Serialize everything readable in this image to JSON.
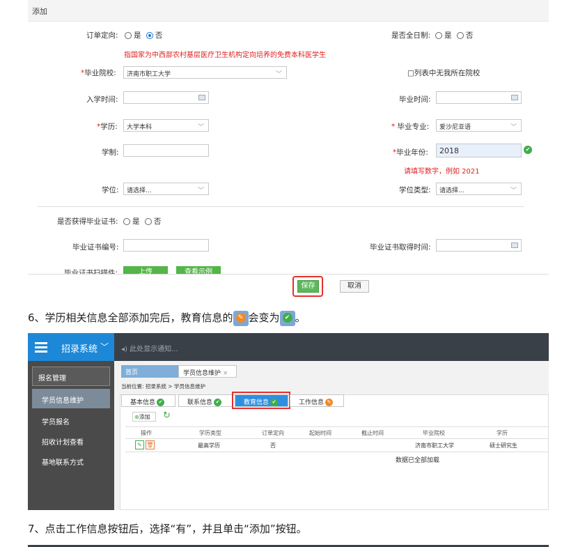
{
  "form": {
    "header": "添加",
    "order_directed": {
      "label": "订单定向:",
      "opt_yes": "是",
      "opt_no": "否",
      "selected": "否"
    },
    "full_time": {
      "label": "是否全日制:",
      "opt_yes": "是",
      "opt_no": "否"
    },
    "order_note": "指国家为中西部农村基层医疗卫生机构定向培养的免费本科医学生",
    "school": {
      "label": "毕业院校:",
      "value": "济南市职工大学"
    },
    "not_in_list": "□列表中无我所在院校",
    "enroll_time": {
      "label": "入学时间:"
    },
    "grad_time": {
      "label": "毕业时间:"
    },
    "degree_level": {
      "label": "学历:",
      "value": "大学本科"
    },
    "major": {
      "label": " 毕业专业:",
      "value": "爱沙尼亚语"
    },
    "study_length": {
      "label": "学制:"
    },
    "grad_year": {
      "label": "毕业年份:",
      "value": "2018"
    },
    "grad_year_hint": "请填写数字，例如 2021",
    "degree": {
      "label": "学位:",
      "value": "请选择..."
    },
    "degree_type": {
      "label": "学位类型:",
      "value": "请选择..."
    },
    "cert": {
      "label": "是否获得毕业证书:",
      "opt_yes": "是",
      "opt_no": "否"
    },
    "cert_no": {
      "label": "毕业证书编号:"
    },
    "cert_time": {
      "label": "毕业证书取得时间:"
    },
    "cert_scan": {
      "label": "毕业证书扫描件:"
    },
    "upload_btn": "上传",
    "view_example_btn": "查看示例",
    "save_btn": "保存",
    "cancel_btn": "取消"
  },
  "step6": {
    "text_a": "6、学历相关信息全部添加完后，教育信息的",
    "text_b": "会变为",
    "text_c": "。"
  },
  "app": {
    "brand": "招录系统",
    "notice": "此处显示通知...",
    "sidebar": {
      "group": "报名管理",
      "items": [
        "学员信息维护",
        "学员报名",
        "招收计划查看",
        "基地联系方式"
      ]
    },
    "tabs": [
      "首页",
      "学员信息维护"
    ],
    "breadcrumb": "当前位置: 招录系统 > 学员信息维护",
    "subtabs": [
      "基本信息",
      "联系信息",
      "教育信息",
      "工作信息"
    ],
    "add_btn": "添加",
    "columns": [
      "操作",
      "学历类型",
      "订单定向",
      "起始时间",
      "截止时间",
      "毕业院校",
      "学历"
    ],
    "row": {
      "type": "最高学历",
      "order": "否",
      "start": "",
      "end": "",
      "school": "济南市职工大学",
      "degree": "硕士研究生"
    },
    "loaded": "数据已全部加载"
  },
  "step7": "7、点击工作信息按钮后，选择“有”，并且单击“添加”按钮。"
}
